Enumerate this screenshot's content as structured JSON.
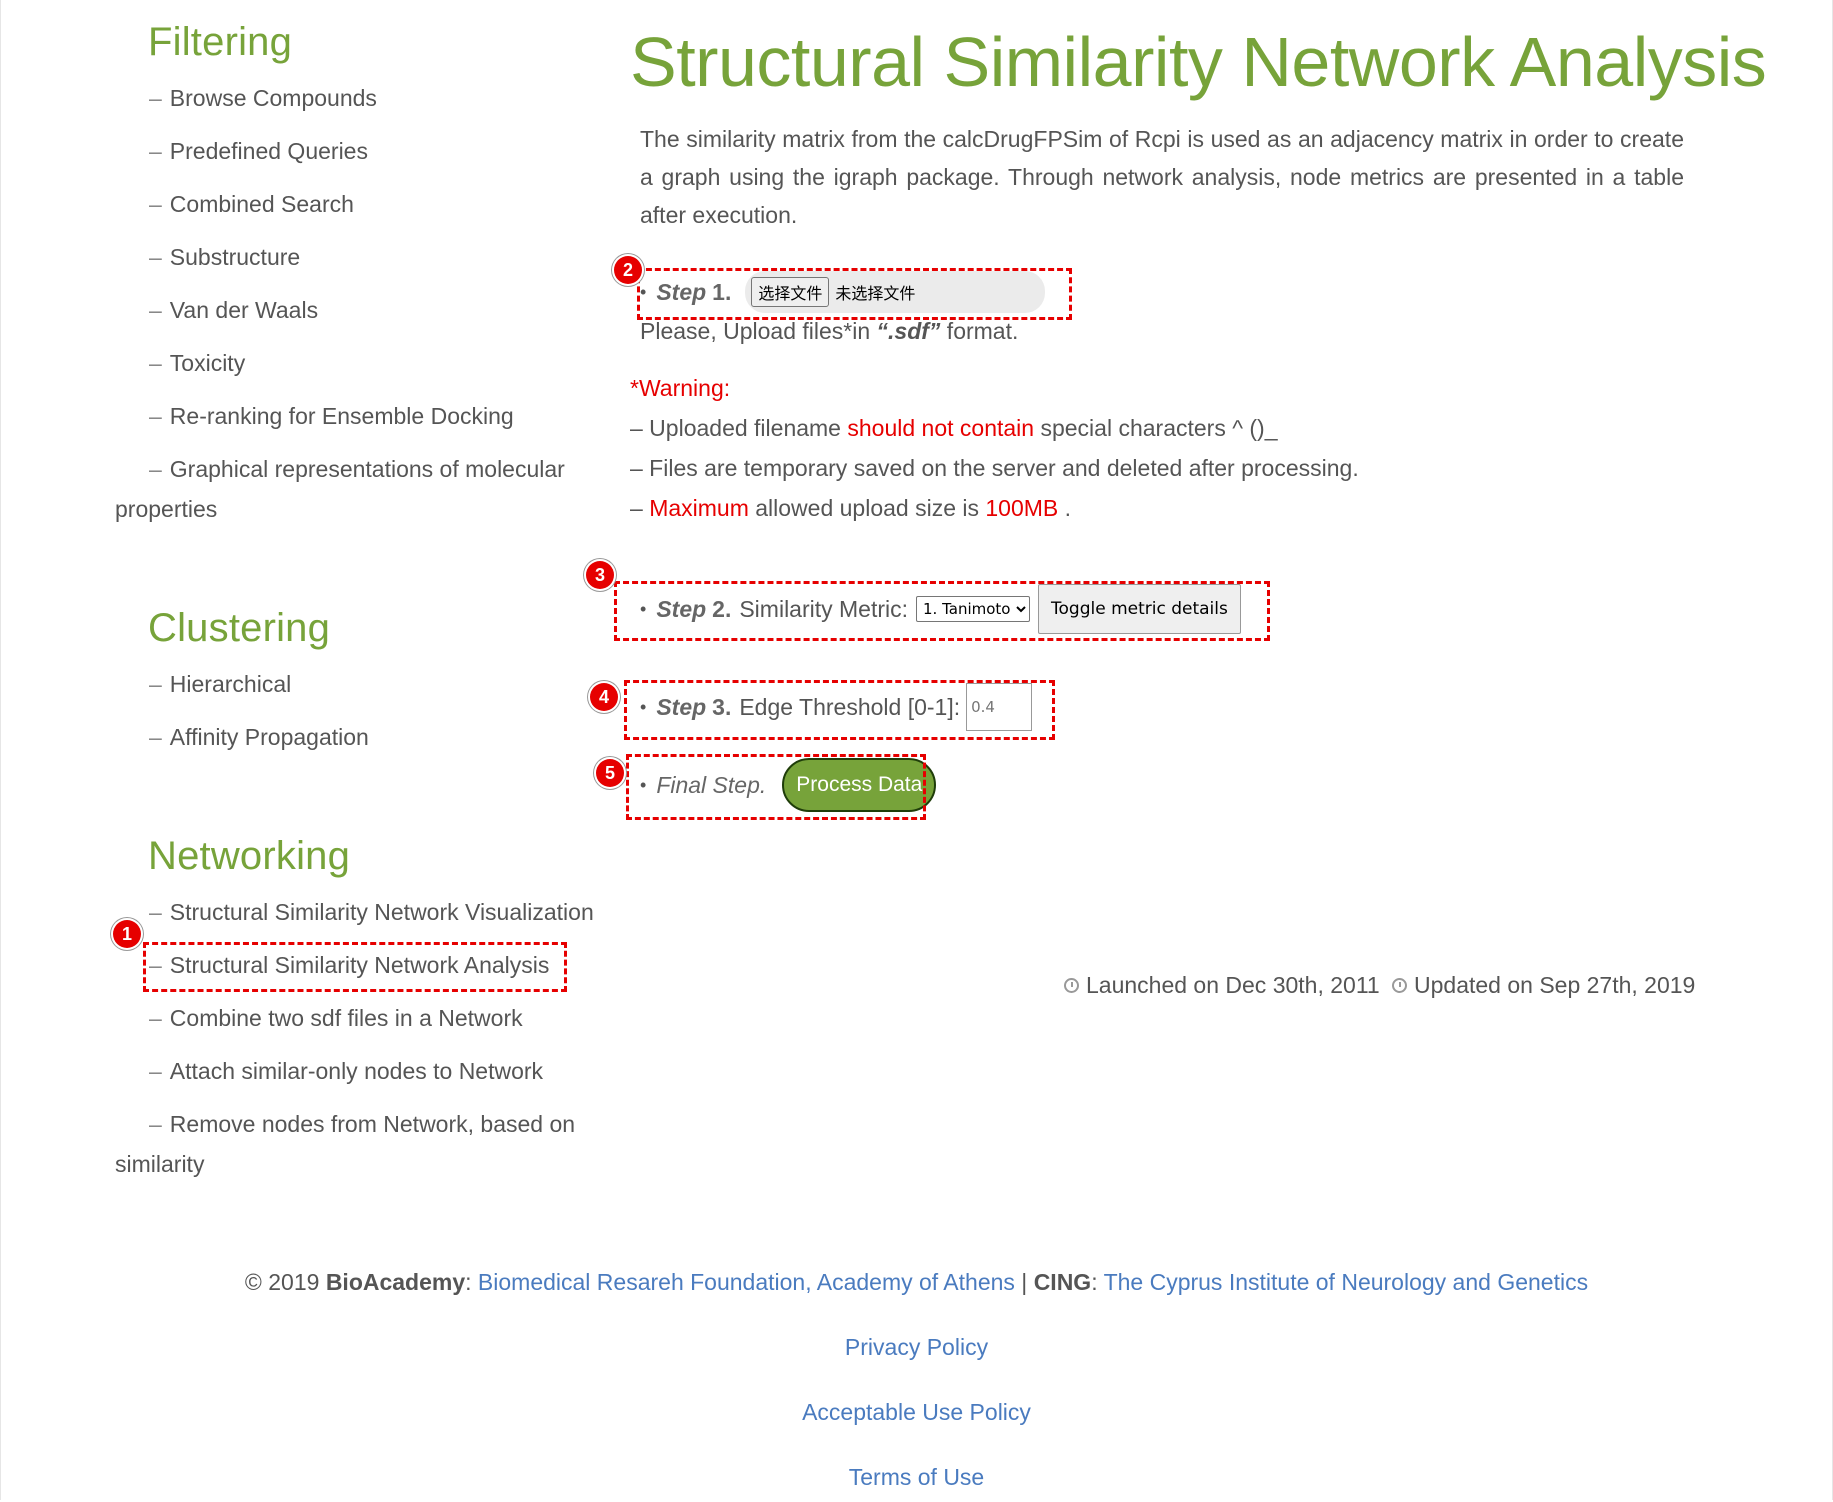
{
  "sidebar": {
    "filtering": {
      "title": "Filtering",
      "items": [
        "Browse Compounds",
        "Predefined Queries",
        "Combined Search",
        "Substructure",
        "Van der Waals",
        "Toxicity",
        "Re-ranking for Ensemble Docking",
        "Graphical representations of molecular properties"
      ]
    },
    "clustering": {
      "title": "Clustering",
      "items": [
        "Hierarchical",
        "Affinity Propagation"
      ]
    },
    "networking": {
      "title": "Networking",
      "items": [
        "Structural Similarity Network Visualization",
        "Structural Similarity Network Analysis",
        "Combine two sdf files in a Network",
        "Attach similar-only nodes to Network",
        "Remove nodes from Network, based on similarity"
      ]
    },
    "dash": "–"
  },
  "main": {
    "title": "Structural Similarity Network Analysis",
    "intro": "The similarity matrix from the calcDrugFPSim of Rcpi is used as an adjacency matrix in order to create a graph using the igraph package. Through network analysis, node metrics are presented in a table after execution.",
    "bullet": "•",
    "step1": {
      "label": "Step",
      "num": "1.",
      "file_button": "选择文件",
      "file_status": "未选择文件",
      "help_prefix": "Please, Upload files*in ",
      "help_ext": "“.sdf”",
      "help_suffix": " format."
    },
    "warning": {
      "title": "*Warning:",
      "line1_a": "– Uploaded filename ",
      "line1_b": "should not contain",
      "line1_c": " special characters ^ ()_",
      "line2": "– Files are temporary saved on the server and deleted after processing.",
      "line3_a": "– ",
      "line3_b": "Maximum",
      "line3_c": " allowed upload size is ",
      "line3_d": "100MB",
      "line3_e": " ."
    },
    "step2": {
      "label": "Step",
      "num": "2.",
      "text": "Similarity Metric:",
      "selected": "1. Tanimoto",
      "toggle": "Toggle metric details"
    },
    "step3": {
      "label": "Step",
      "num": "3.",
      "text": "Edge Threshold [0-1]:",
      "placeholder": "0.4"
    },
    "final": {
      "label": "Final Step.",
      "button": "Process Data"
    },
    "launched": "Launched on Dec 30th, 2011",
    "updated": "Updated on Sep 27th, 2019"
  },
  "annotations": [
    "1",
    "2",
    "3",
    "4",
    "5"
  ],
  "footer": {
    "copyright": "© 2019 ",
    "bioacademy": "BioAcademy",
    "colon1": ": ",
    "bioacademy_link": "Biomedical Resareh Foundation, Academy of Athens",
    "sep": " | ",
    "cing": "CING",
    "colon2": ": ",
    "cing_link": "The Cyprus Institute of Neurology and Genetics",
    "privacy": "Privacy Policy",
    "aup": "Acceptable Use Policy",
    "terms": "Terms of Use"
  },
  "colors": {
    "brand_green": "#77a33a",
    "annotation_red": "#e60000",
    "link_blue": "#4a7bbf"
  }
}
